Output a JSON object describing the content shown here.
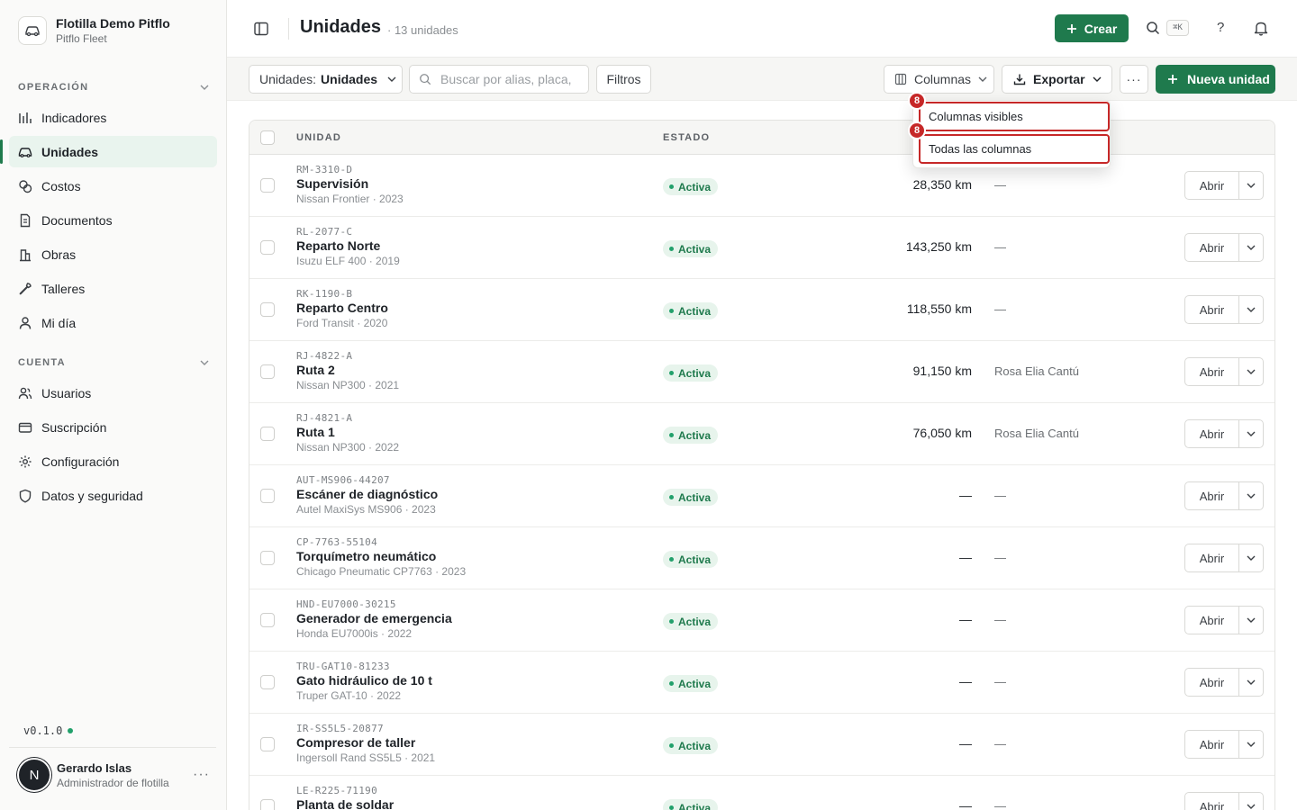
{
  "org": {
    "name": "Flotilla Demo Pitflo",
    "sub": "Pitflo Fleet"
  },
  "sidebar": {
    "section_operacion": "OPERACIÓN",
    "section_cuenta": "CUENTA",
    "operacion": [
      {
        "label": "Indicadores",
        "icon": "bar-chart-icon"
      },
      {
        "label": "Unidades",
        "icon": "car-icon",
        "active": true
      },
      {
        "label": "Costos",
        "icon": "coins-icon"
      },
      {
        "label": "Documentos",
        "icon": "document-icon"
      },
      {
        "label": "Obras",
        "icon": "building-icon"
      },
      {
        "label": "Talleres",
        "icon": "wrench-icon"
      },
      {
        "label": "Mi día",
        "icon": "user-icon"
      }
    ],
    "cuenta": [
      {
        "label": "Usuarios",
        "icon": "users-icon"
      },
      {
        "label": "Suscripción",
        "icon": "credit-card-icon"
      },
      {
        "label": "Configuración",
        "icon": "gear-icon"
      },
      {
        "label": "Datos y seguridad",
        "icon": "shield-icon"
      }
    ],
    "version": "v0.1.0"
  },
  "user": {
    "initial": "N",
    "name": "Gerardo Islas",
    "role": "Administrador de flotilla",
    "more": "···"
  },
  "header": {
    "title": "Unidades",
    "count": "· 13 unidades",
    "create_label": "Crear",
    "kbd": "⌘K",
    "help": "?"
  },
  "toolbar": {
    "view_prefix": "Unidades:",
    "view_value": "Unidades",
    "search_placeholder": "Buscar por alias, placa,",
    "filters_label": "Filtros",
    "columns_label": "Columnas",
    "export_label": "Exportar",
    "more_label": "···",
    "new_label": "Nueva unidad"
  },
  "table": {
    "col_unidad": "UNIDAD",
    "col_estado": "ESTADO",
    "open_label": "Abrir",
    "rows": [
      {
        "code": "RM-3310-D",
        "name": "Supervisión",
        "model": "Nissan Frontier · 2023",
        "status": "Activa",
        "km": "28,350 km",
        "driver": "—"
      },
      {
        "code": "RL-2077-C",
        "name": "Reparto Norte",
        "model": "Isuzu ELF 400 · 2019",
        "status": "Activa",
        "km": "143,250 km",
        "driver": "—"
      },
      {
        "code": "RK-1190-B",
        "name": "Reparto Centro",
        "model": "Ford Transit · 2020",
        "status": "Activa",
        "km": "118,550 km",
        "driver": "—"
      },
      {
        "code": "RJ-4822-A",
        "name": "Ruta 2",
        "model": "Nissan NP300 · 2021",
        "status": "Activa",
        "km": "91,150 km",
        "driver": "Rosa Elia Cantú"
      },
      {
        "code": "RJ-4821-A",
        "name": "Ruta 1",
        "model": "Nissan NP300 · 2022",
        "status": "Activa",
        "km": "76,050 km",
        "driver": "Rosa Elia Cantú"
      },
      {
        "code": "AUT-MS906-44207",
        "name": "Escáner de diagnóstico",
        "model": "Autel MaxiSys MS906 · 2023",
        "status": "Activa",
        "km": "—",
        "driver": "—"
      },
      {
        "code": "CP-7763-55104",
        "name": "Torquímetro neumático",
        "model": "Chicago Pneumatic CP7763 · 2023",
        "status": "Activa",
        "km": "—",
        "driver": "—"
      },
      {
        "code": "HND-EU7000-30215",
        "name": "Generador de emergencia",
        "model": "Honda EU7000is · 2022",
        "status": "Activa",
        "km": "—",
        "driver": "—"
      },
      {
        "code": "TRU-GAT10-81233",
        "name": "Gato hidráulico de 10 t",
        "model": "Truper GAT-10 · 2022",
        "status": "Activa",
        "km": "—",
        "driver": "—"
      },
      {
        "code": "IR-SS5L5-20877",
        "name": "Compresor de taller",
        "model": "Ingersoll Rand SS5L5 · 2021",
        "status": "Activa",
        "km": "—",
        "driver": "—"
      },
      {
        "code": "LE-R225-71190",
        "name": "Planta de soldar",
        "model": "",
        "status": "Activa",
        "km": "—",
        "driver": "—"
      }
    ]
  },
  "dropdown": {
    "items": [
      {
        "label": "Columnas visibles",
        "badge": "8"
      },
      {
        "label": "Todas las columnas",
        "badge": "8"
      }
    ]
  },
  "colors": {
    "accent": "#1f7a4d",
    "highlight": "#c62828"
  }
}
